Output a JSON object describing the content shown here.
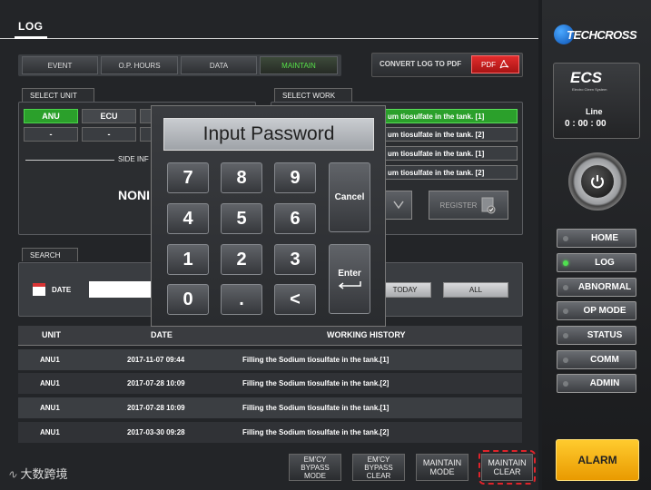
{
  "header": {
    "title": "LOG"
  },
  "tabs": [
    {
      "label": "EVENT"
    },
    {
      "label": "O.P. HOURS"
    },
    {
      "label": "DATA"
    },
    {
      "label": "MAINTAIN"
    }
  ],
  "convert": {
    "label": "CONVERT LOG TO PDF",
    "button": "PDF"
  },
  "select_unit": {
    "label": "SELECT UNIT",
    "units": [
      "ANU",
      "ECU",
      "-",
      "-"
    ],
    "side_info_label": "SIDE INF",
    "none_text": "NONI"
  },
  "select_work": {
    "label": "SELECT WORK",
    "items": [
      "um tiosulfate in the tank. [1]",
      "um tiosulfate in the tank. [2]",
      "um tiosulfate in the tank. [1]",
      "um tiosulfate in the tank. [2]"
    ],
    "register_label": "REGISTER"
  },
  "search": {
    "label": "SEARCH",
    "date_label": "DATE",
    "today_label": "TODAY",
    "all_label": "ALL"
  },
  "table": {
    "headers": [
      "UNIT",
      "DATE",
      "WORKING HISTORY"
    ],
    "rows": [
      {
        "unit": "ANU1",
        "date": "2017-11-07 09:44",
        "history": "Filling the Sodium tiosulfate in the tank.[1]"
      },
      {
        "unit": "ANU1",
        "date": "2017-07-28 10:09",
        "history": "Filling the Sodium tiosulfate in the tank.[2]"
      },
      {
        "unit": "ANU1",
        "date": "2017-07-28 10:09",
        "history": "Filling the Sodium tiosulfate in the tank.[1]"
      },
      {
        "unit": "ANU1",
        "date": "2017-03-30 09:28",
        "history": "Filling the Sodium tiosulfate in the tank.[2]"
      }
    ]
  },
  "bottom": {
    "emcy_bypass_mode": [
      "EM'CY BYPASS",
      "MODE"
    ],
    "emcy_bypass_clear": [
      "EM'CY BYPASS",
      "CLEAR"
    ],
    "maintain_mode": [
      "MAINTAIN",
      "MODE"
    ],
    "maintain_clear": [
      "MAINTAIN",
      "CLEAR"
    ],
    "watermark": "大数跨境"
  },
  "modal": {
    "title": "Input Password",
    "keys": [
      "7",
      "8",
      "9",
      "4",
      "5",
      "6",
      "1",
      "2",
      "3",
      "0",
      ".",
      "<"
    ],
    "cancel": "Cancel",
    "enter": "Enter"
  },
  "sidebar": {
    "brand": "TECHCROSS",
    "ecs": "ECS",
    "ecs_sub": "Electro Cleen System",
    "line_label": "Line",
    "line_time": "0 : 00 : 00",
    "nav": [
      "HOME",
      "LOG",
      "ABNORMAL",
      "OP MODE",
      "STATUS",
      "COMM",
      "ADMIN"
    ],
    "alarm": "ALARM"
  }
}
